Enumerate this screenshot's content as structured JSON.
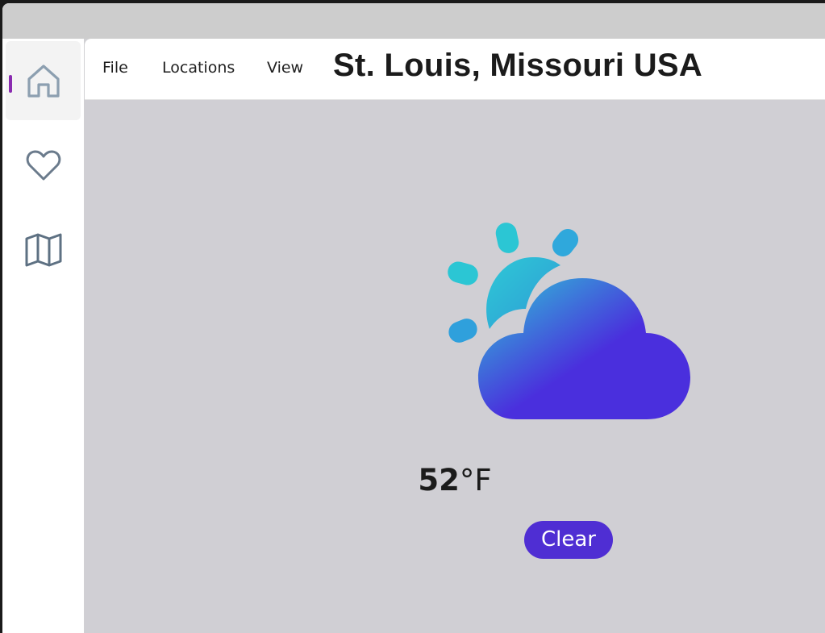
{
  "menu": {
    "file": "File",
    "locations": "Locations",
    "view": "View"
  },
  "page": {
    "title": "St. Louis, Missouri USA"
  },
  "sidebar": {
    "items": [
      {
        "icon": "home-icon",
        "selected": true
      },
      {
        "icon": "heart-icon",
        "selected": false
      },
      {
        "icon": "map-icon",
        "selected": false
      }
    ]
  },
  "weather": {
    "icon": "partly-cloudy-icon",
    "temperature": "52",
    "unit": "°F",
    "condition": "Clear"
  },
  "colors": {
    "accent": "#8a2bb0",
    "badge": "#4f2ed3",
    "icon_gradient_start": "#2ec9d6",
    "icon_gradient_end": "#4a2fdd"
  }
}
